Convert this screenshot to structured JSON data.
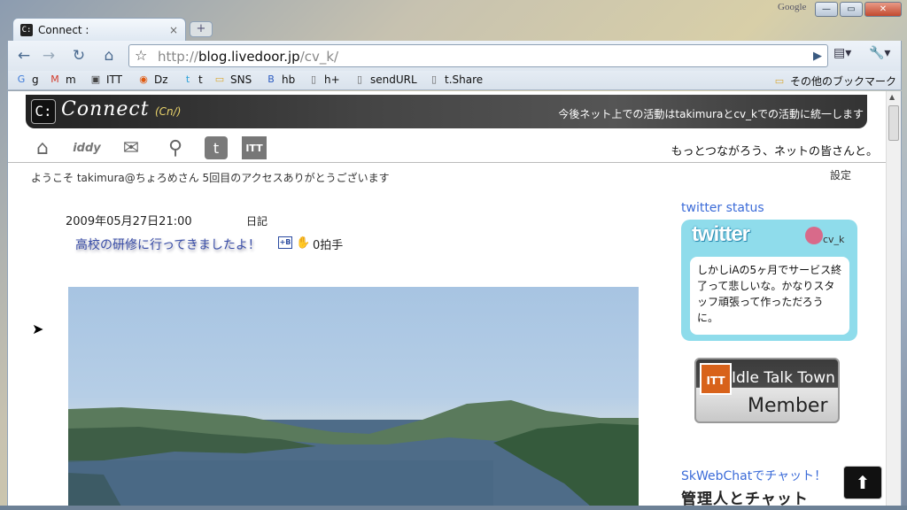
{
  "browser": {
    "tab_title": "Connect :",
    "tab_close": "×",
    "new_tab": "+",
    "google_label": "Google",
    "window_buttons": {
      "minimize": "—",
      "maximize": "▭",
      "close": "✕"
    },
    "nav": {
      "back": "←",
      "forward": "→",
      "reload": "↻",
      "home": "⌂"
    },
    "url_scheme": "http://",
    "url_host": "blog.livedoor.jp",
    "url_path": "/cv_k/",
    "go": "▶",
    "page_menu": "▤▾",
    "wrench_menu": "🔧▾",
    "bookmarks": [
      {
        "icon": "G",
        "label": "g"
      },
      {
        "icon": "M",
        "label": "m"
      },
      {
        "icon": "▣",
        "label": "ITT"
      },
      {
        "icon": "◉",
        "label": "Dz"
      },
      {
        "icon": "t",
        "label": "t"
      },
      {
        "icon": "▭",
        "label": "SNS"
      },
      {
        "icon": "B",
        "label": "hb"
      },
      {
        "icon": "▯",
        "label": "h+"
      },
      {
        "icon": "▯",
        "label": "sendURL"
      },
      {
        "icon": "▯",
        "label": "t.Share"
      }
    ],
    "other_bookmarks": "その他のブックマーク"
  },
  "blog": {
    "logo_letter": "C:",
    "title": "Connect",
    "subtitle": "(Cn/)",
    "tagline": "今後ネット上での活動はtakimuraとcv_kでの活動に統一します",
    "icons": {
      "iddy": "iddy",
      "twitter": "t",
      "itt": "ITT"
    },
    "motto": "もっとつながろう、ネットの皆さんと。",
    "welcome": "ようこそ takimura@ちょろめさん 5回目のアクセスありがとうございます",
    "settings": "設定",
    "post": {
      "date": "2009年05月27日21:00",
      "category": "日記",
      "title": "高校の研修に行ってきましたよ！",
      "hatena": "+B",
      "clap_count": "0拍手"
    },
    "sidebar": {
      "twitter_heading": "twitter status",
      "twitter_logo": "twitter",
      "twitter_user": "cv_k",
      "tweet": "しかしiAの5ヶ月でサービス終了って悲しいな。かなりスタッフ頑張って作っただろうに。",
      "badge_icon": "ITT",
      "badge_top": "Idle Talk Town",
      "badge_bottom": "Member",
      "skweb_link": "SkWebChatでチャット！",
      "skweb_banner": "管理人とチャット"
    },
    "top_button": "⬆"
  }
}
